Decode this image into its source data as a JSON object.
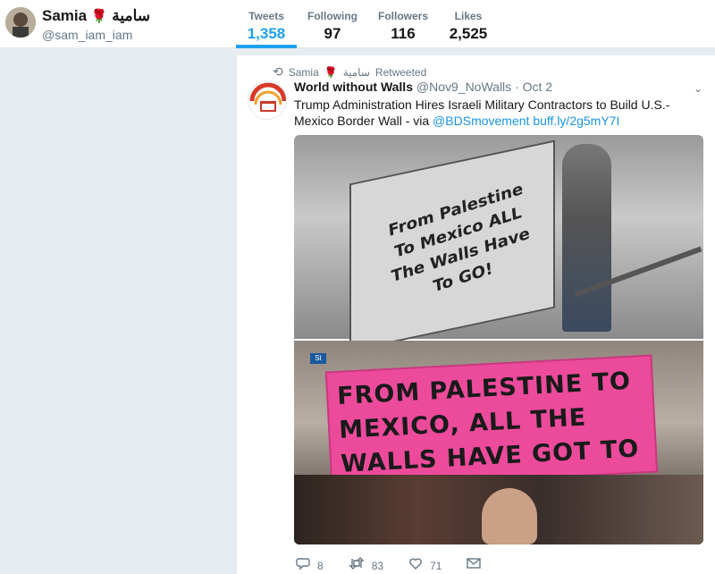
{
  "profile": {
    "name": "Samia",
    "name_arabic": "سامية",
    "handle": "@sam_iam_iam"
  },
  "stats": [
    {
      "label": "Tweets",
      "value": "1,358"
    },
    {
      "label": "Following",
      "value": "97"
    },
    {
      "label": "Followers",
      "value": "116"
    },
    {
      "label": "Likes",
      "value": "2,525"
    }
  ],
  "tweet": {
    "retweet_user": "Samia",
    "retweet_user_arabic": "سامية",
    "retweet_label": "Retweeted",
    "author_name": "World without Walls",
    "author_handle": "@Nov9_NoWalls",
    "date": "· Oct 2",
    "text_before": "Trump Administration Hires Israeli Military Contractors to Build U.S.-Mexico Border Wall - via ",
    "mention": "@BDSmovement",
    "link": "buff.ly/2g5mY7I",
    "image1_sign_text": "From Palestine To Mexico ALL The Walls Have To GO!",
    "image2_sign_text": "FROM PALESTINE TO MEXICO, ALL THE WALLS HAVE GOT TO GO",
    "image2_street_sign": "St",
    "replies": "8",
    "retweets": "83",
    "likes": "71"
  },
  "colors": {
    "accent": "#1da1f2",
    "link": "#1b95e0",
    "background": "#e6ecf0",
    "rose": "#c8102e"
  },
  "icons": [
    "rose-icon",
    "retweet-icon",
    "caret-down-icon",
    "reply-icon",
    "like-icon",
    "message-icon"
  ]
}
